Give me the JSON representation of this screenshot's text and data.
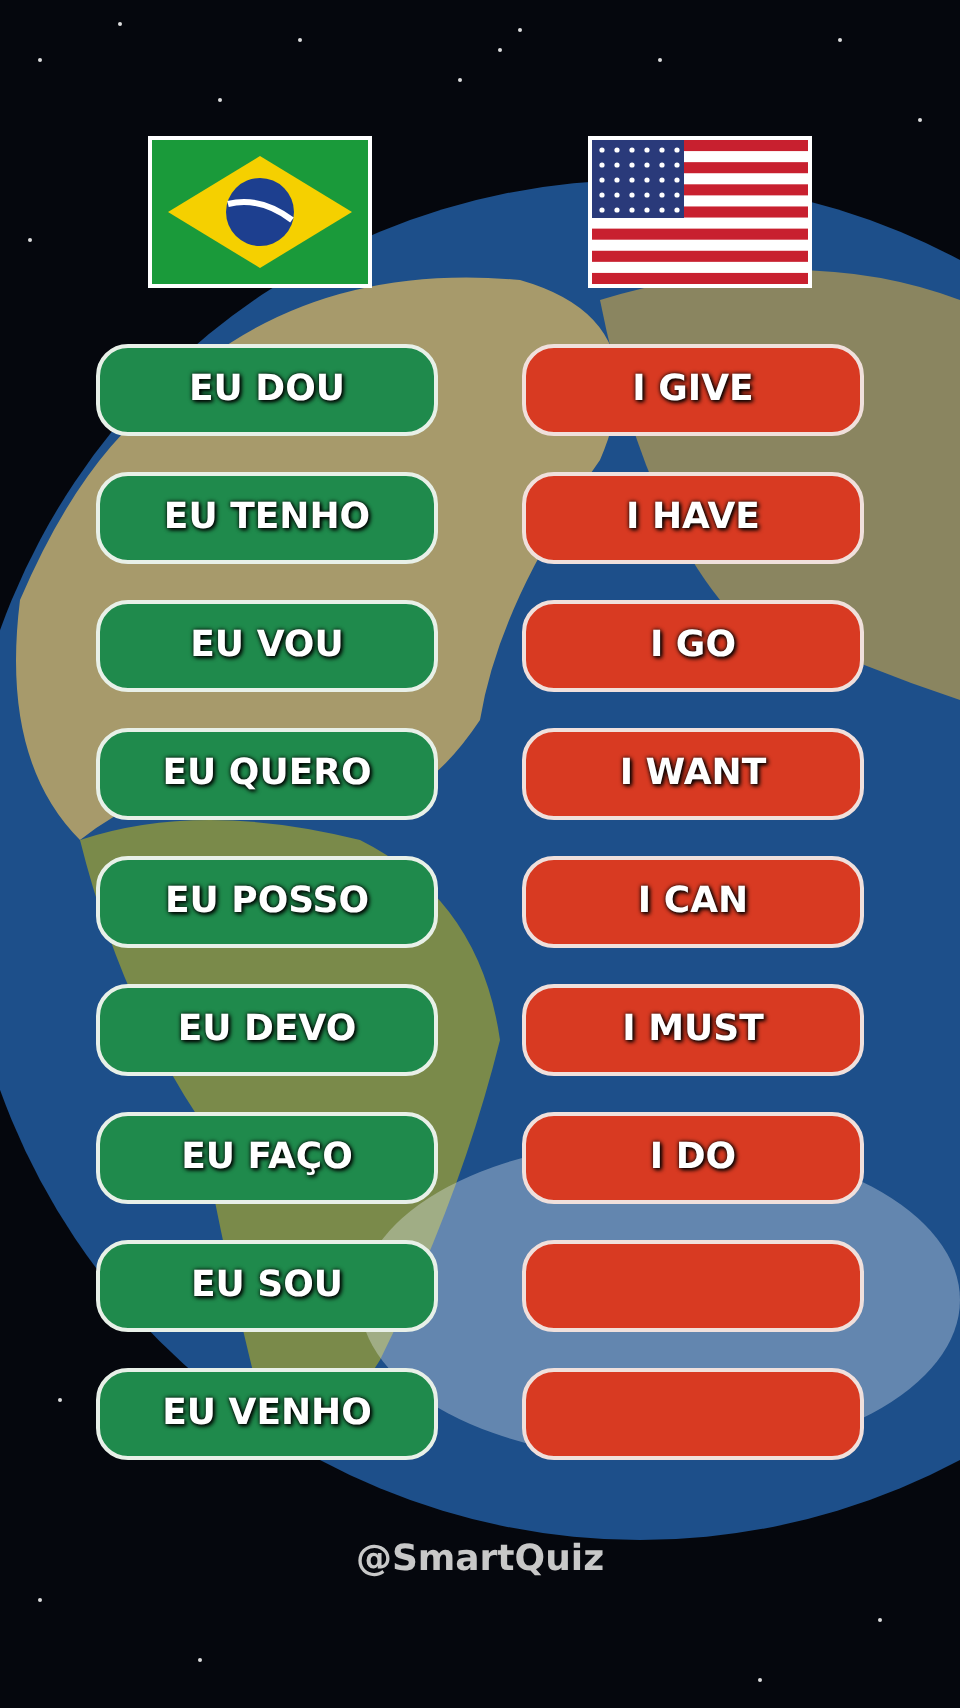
{
  "languages": [
    {
      "kind": "brazil"
    },
    {
      "kind": "usa"
    }
  ],
  "pairs": [
    {
      "portuguese": "EU DOU",
      "english": "I GIVE"
    },
    {
      "portuguese": "EU TENHO",
      "english": "I HAVE"
    },
    {
      "portuguese": "EU VOU",
      "english": "I GO"
    },
    {
      "portuguese": "EU QUERO",
      "english": "I WANT"
    },
    {
      "portuguese": "EU POSSO",
      "english": "I CAN"
    },
    {
      "portuguese": "EU DEVO",
      "english": "I MUST"
    },
    {
      "portuguese": "EU FAÇO",
      "english": "I DO"
    },
    {
      "portuguese": "EU SOU"
    },
    {
      "portuguese": "EU VENHO"
    }
  ],
  "handle": "@SmartQuiz"
}
